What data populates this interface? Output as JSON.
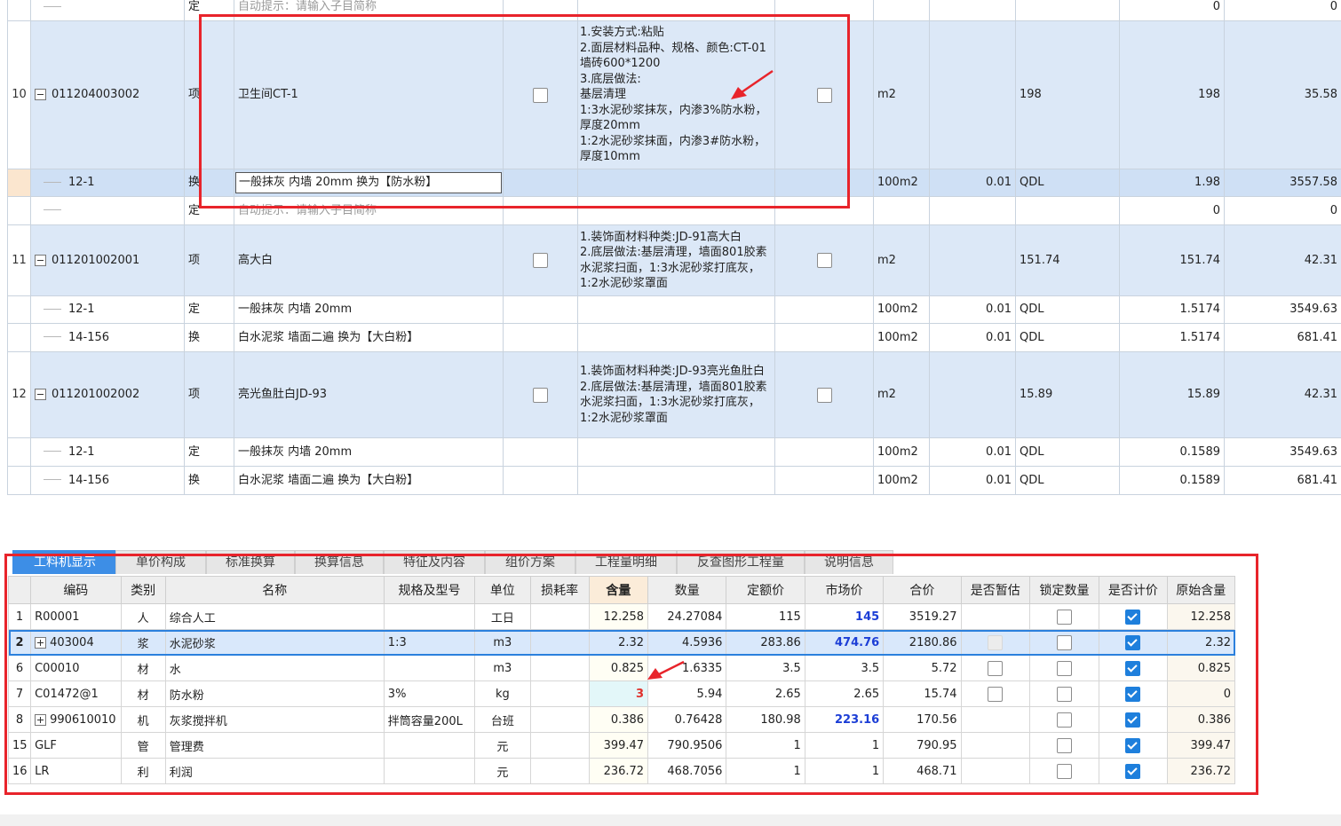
{
  "top_rows": [
    {
      "kind": "sub",
      "rn": "",
      "code": "",
      "type": "定",
      "name": "自动提示：请输入子目简称",
      "hint": true,
      "unit": "",
      "coef": "",
      "qexpr": "",
      "qty": "0",
      "price": "0"
    },
    {
      "kind": "item",
      "rn": "10",
      "code": "011204003002",
      "type": "项",
      "name": "卫生间CT-1",
      "desc": "1.安装方式:粘贴\n2.面层材料品种、规格、颜色:CT-01墙砖600*1200\n3.底层做法:\n基层清理\n1:3水泥砂浆抹灰，内渗3%防水粉，厚度20mm\n1:2水泥砂浆抹面，内渗3#防水粉，厚度10mm",
      "unit": "m2",
      "coef": "",
      "qexpr": "198",
      "qty": "198",
      "price": "35.58"
    },
    {
      "kind": "sel",
      "rn": "",
      "code": "12-1",
      "type": "换",
      "name": "一般抹灰 内墙 20mm  换为【防水粉】",
      "unit": "100m2",
      "coef": "0.01",
      "qexpr": "QDL",
      "qty": "1.98",
      "price": "3557.58"
    },
    {
      "kind": "sub",
      "rn": "",
      "code": "",
      "type": "定",
      "name": "自动提示：请输入子目简称",
      "hint": true,
      "unit": "",
      "coef": "",
      "qexpr": "",
      "qty": "0",
      "price": "0"
    },
    {
      "kind": "item",
      "rn": "11",
      "code": "011201002001",
      "type": "项",
      "name": "高大白",
      "desc": "1.装饰面材料种类:JD-91高大白\n2.底层做法:基层清理，墙面801胶素水泥浆扫面，1:3水泥砂浆打底灰，1:2水泥砂浆罩面",
      "unit": "m2",
      "coef": "",
      "qexpr": "151.74",
      "qty": "151.74",
      "price": "42.31"
    },
    {
      "kind": "sub",
      "rn": "",
      "code": "12-1",
      "type": "定",
      "name": "一般抹灰 内墙 20mm",
      "unit": "100m2",
      "coef": "0.01",
      "qexpr": "QDL",
      "qty": "1.5174",
      "price": "3549.63"
    },
    {
      "kind": "sub",
      "rn": "",
      "code": "14-156",
      "type": "换",
      "name": "白水泥浆 墙面二遍  换为【大白粉】",
      "unit": "100m2",
      "coef": "0.01",
      "qexpr": "QDL",
      "qty": "1.5174",
      "price": "681.41"
    },
    {
      "kind": "item",
      "rn": "12",
      "code": "011201002002",
      "type": "项",
      "name": "亮光鱼肚白JD-93",
      "desc": "1.装饰面材料种类:JD-93亮光鱼肚白\n2.底层做法:基层清理，墙面801胶素水泥浆扫面，1:3水泥砂浆打底灰，1:2水泥砂浆罩面",
      "unit": "m2",
      "coef": "",
      "qexpr": "15.89",
      "qty": "15.89",
      "price": "42.31"
    },
    {
      "kind": "sub",
      "rn": "",
      "code": "12-1",
      "type": "定",
      "name": "一般抹灰 内墙 20mm",
      "unit": "100m2",
      "coef": "0.01",
      "qexpr": "QDL",
      "qty": "0.1589",
      "price": "3549.63"
    },
    {
      "kind": "sub",
      "rn": "",
      "code": "14-156",
      "type": "换",
      "name": "白水泥浆 墙面二遍  换为【大白粉】",
      "unit": "100m2",
      "coef": "0.01",
      "qexpr": "QDL",
      "qty": "0.1589",
      "price": "681.41"
    }
  ],
  "tabs": [
    "工料机显示",
    "单价构成",
    "标准换算",
    "换算信息",
    "特征及内容",
    "组价方案",
    "工程量明细",
    "反查图形工程量",
    "说明信息"
  ],
  "bottom_headers": [
    "",
    "编码",
    "类别",
    "名称",
    "规格及型号",
    "单位",
    "损耗率",
    "含量",
    "数量",
    "定额价",
    "市场价",
    "合价",
    "是否暂估",
    "锁定数量",
    "是否计价",
    "原始含量"
  ],
  "bottom_rows": [
    {
      "rn": "1",
      "expand": false,
      "code": "R00001",
      "cat": "人",
      "name": "综合人工",
      "spec": "",
      "unit": "工日",
      "loss": "",
      "amount": "12.258",
      "qty": "24.27084",
      "base": "115",
      "market": "145",
      "market_hl": true,
      "total": "3519.27",
      "est": "none",
      "lock": false,
      "priced": true,
      "orig": "12.258"
    },
    {
      "rn": "2",
      "expand": true,
      "code": "403004",
      "cat": "浆",
      "name": "水泥砂浆",
      "spec": "1:3",
      "unit": "m3",
      "loss": "",
      "amount": "2.32",
      "qty": "4.5936",
      "base": "283.86",
      "market": "474.76",
      "market_hl": true,
      "total": "2180.86",
      "est": "dis",
      "lock": false,
      "priced": true,
      "orig": "2.32",
      "sel": true
    },
    {
      "rn": "6",
      "expand": false,
      "code": "C00010",
      "cat": "材",
      "name": "水",
      "spec": "",
      "unit": "m3",
      "loss": "",
      "amount": "0.825",
      "qty": "1.6335",
      "base": "3.5",
      "market": "3.5",
      "market_hl": false,
      "total": "5.72",
      "est": "off",
      "lock": false,
      "priced": true,
      "orig": "0.825"
    },
    {
      "rn": "7",
      "expand": false,
      "code": "C01472@1",
      "cat": "材",
      "name": "防水粉",
      "spec": "3%",
      "unit": "kg",
      "loss": "",
      "amount": "3",
      "amount_red": true,
      "qty": "5.94",
      "base": "2.65",
      "market": "2.65",
      "market_hl": false,
      "total": "15.74",
      "est": "off",
      "lock": false,
      "priced": true,
      "orig": "0"
    },
    {
      "rn": "8",
      "expand": true,
      "code": "990610010",
      "cat": "机",
      "name": "灰浆搅拌机",
      "spec": "拌筒容量200L",
      "unit": "台班",
      "loss": "",
      "amount": "0.386",
      "qty": "0.76428",
      "base": "180.98",
      "market": "223.16",
      "market_hl": true,
      "total": "170.56",
      "est": "none",
      "lock": false,
      "priced": true,
      "orig": "0.386"
    },
    {
      "rn": "15",
      "expand": false,
      "code": "GLF",
      "cat": "管",
      "name": "管理费",
      "spec": "",
      "unit": "元",
      "loss": "",
      "amount": "399.47",
      "qty": "790.9506",
      "base": "1",
      "market": "1",
      "market_hl": false,
      "total": "790.95",
      "est": "none",
      "lock": false,
      "priced": true,
      "orig": "399.47"
    },
    {
      "rn": "16",
      "expand": false,
      "code": "LR",
      "cat": "利",
      "name": "利润",
      "spec": "",
      "unit": "元",
      "loss": "",
      "amount": "236.72",
      "qty": "468.7056",
      "base": "1",
      "market": "1",
      "market_hl": false,
      "total": "468.71",
      "est": "none",
      "lock": false,
      "priced": true,
      "orig": "236.72"
    }
  ],
  "colors": {
    "accent": "#3d8ee6",
    "highlight_box": "#e8242b",
    "selected_row": "#d9e8fb"
  }
}
